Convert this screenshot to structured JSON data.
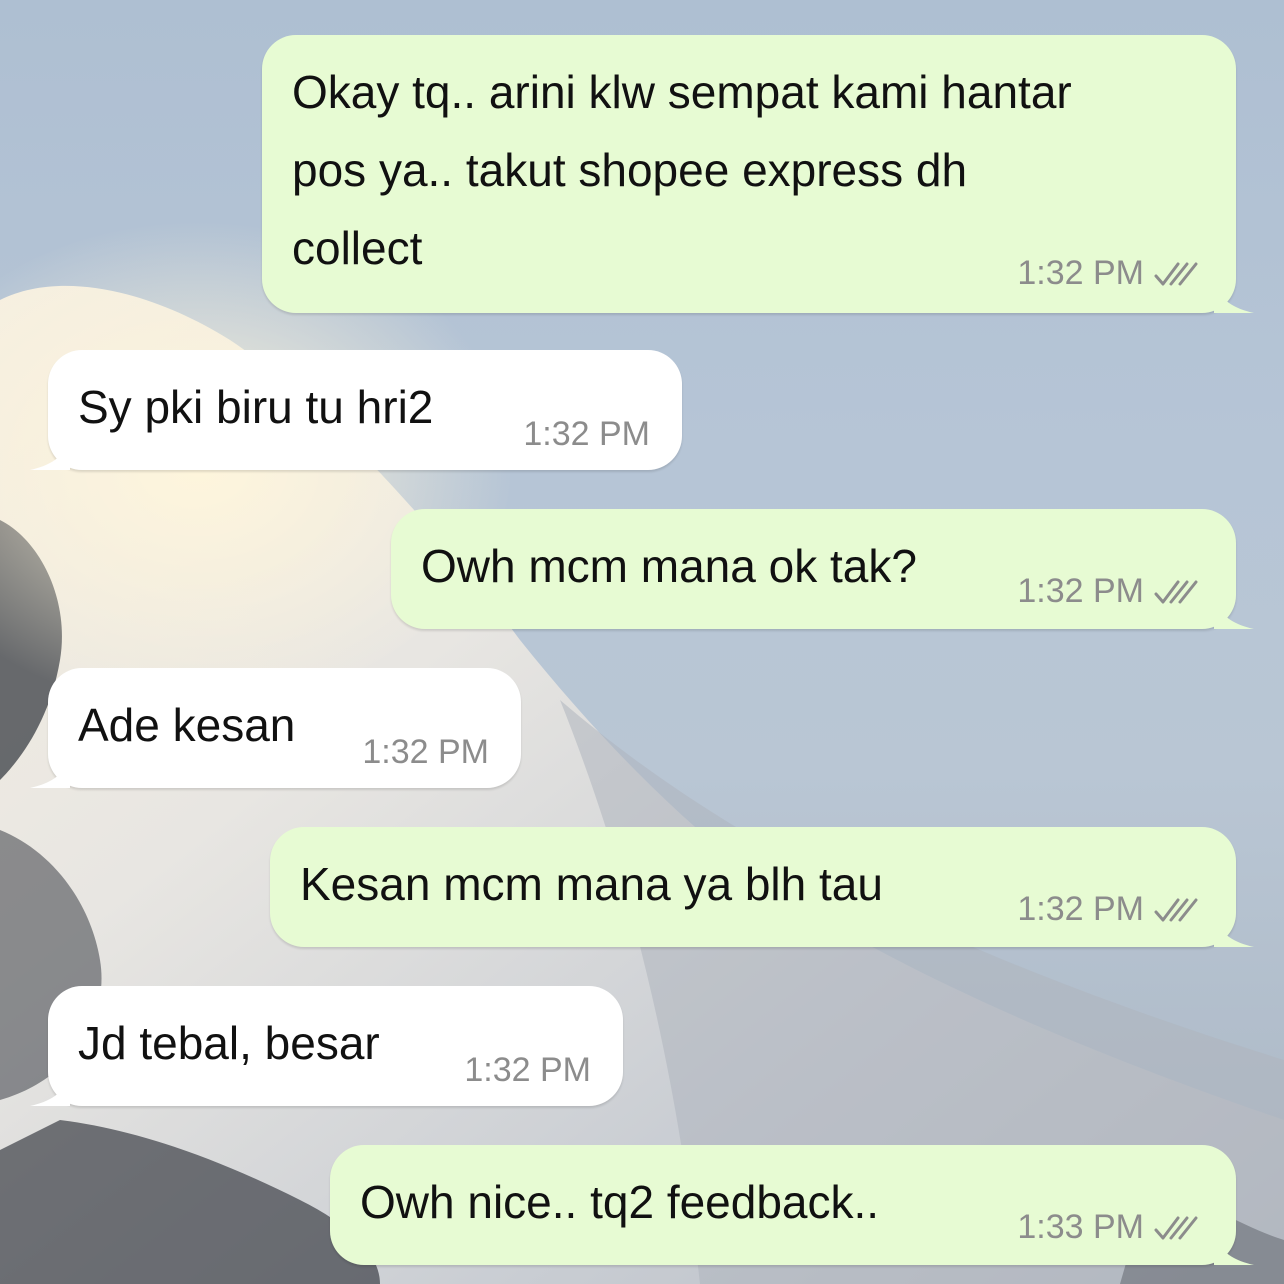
{
  "chat": {
    "messages": [
      {
        "direction": "out",
        "text": "Okay tq.. arini klw sempat kami hantar\npos ya.. takut shopee express dh\ncollect",
        "time": "1:32 PM",
        "status": "read"
      },
      {
        "direction": "in",
        "text": "Sy pki biru tu hri2",
        "time": "1:32 PM"
      },
      {
        "direction": "out",
        "text": "Owh mcm mana ok tak?",
        "time": "1:32 PM",
        "status": "read"
      },
      {
        "direction": "in",
        "text": "Ade kesan",
        "time": "1:32 PM"
      },
      {
        "direction": "out",
        "text": "Kesan mcm mana ya blh tau",
        "time": "1:32 PM",
        "status": "read"
      },
      {
        "direction": "in",
        "text": "Jd tebal, besar",
        "time": "1:32 PM"
      },
      {
        "direction": "out",
        "text": "Owh nice.. tq2 feedback..",
        "time": "1:33 PM",
        "status": "read"
      }
    ]
  },
  "colors": {
    "outgoing_bubble": "#e7fbd3",
    "incoming_bubble": "#ffffff",
    "timestamp": "#8c8c8c",
    "read_ticks": "#8c8c8c"
  },
  "icons": {
    "read_receipt": "double-check-icon"
  }
}
